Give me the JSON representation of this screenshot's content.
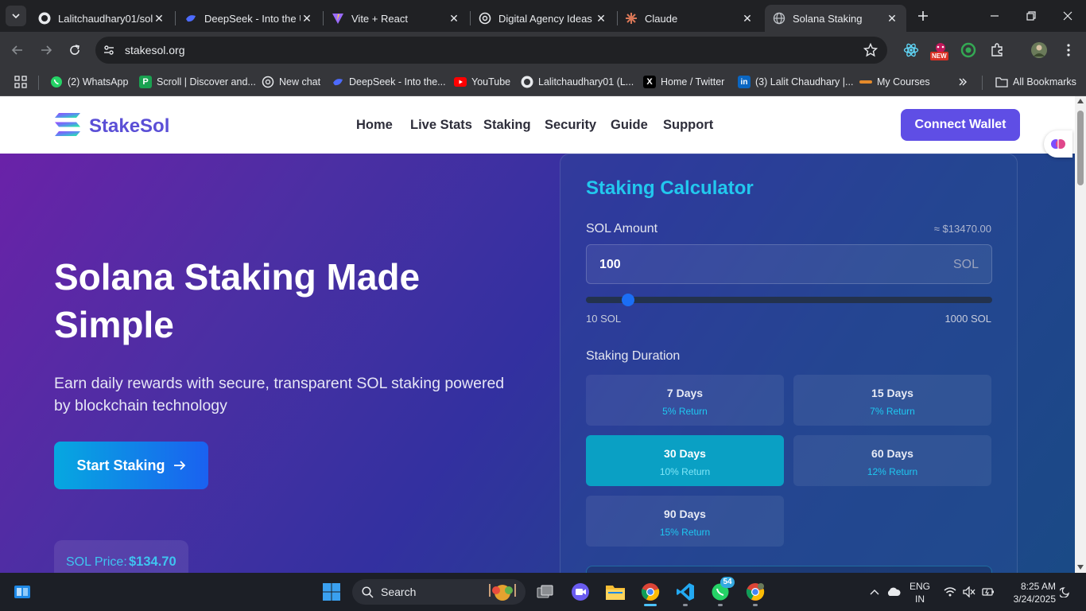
{
  "browser": {
    "tabs": [
      {
        "title": "Lalitchaudhary01/sol",
        "icon": "github-icon"
      },
      {
        "title": "DeepSeek - Into the U",
        "icon": "deepseek-icon"
      },
      {
        "title": "Vite + React",
        "icon": "vite-icon"
      },
      {
        "title": "Digital Agency Ideas",
        "icon": "openai-icon"
      },
      {
        "title": "Claude",
        "icon": "claude-icon"
      },
      {
        "title": "Solana Staking",
        "icon": "globe-icon",
        "active": true
      }
    ],
    "url": "stakesol.org",
    "new_badge": "NEW",
    "bookmarks": [
      {
        "label": "(2) WhatsApp",
        "icon": "whatsapp-icon"
      },
      {
        "label": "Scroll | Discover and...",
        "icon": "scroll-icon"
      },
      {
        "label": "New chat",
        "icon": "openai-icon"
      },
      {
        "label": "DeepSeek - Into the...",
        "icon": "deepseek-icon"
      },
      {
        "label": "YouTube",
        "icon": "youtube-icon"
      },
      {
        "label": "Lalitchaudhary01 (L...",
        "icon": "github-icon"
      },
      {
        "label": "Home / Twitter",
        "icon": "x-icon"
      },
      {
        "label": "(3) Lalit Chaudhary |...",
        "icon": "linkedin-icon"
      },
      {
        "label": "My Courses",
        "icon": "courses-icon"
      }
    ],
    "all_bookmarks": "All Bookmarks"
  },
  "site": {
    "brand": "StakeSol",
    "nav": [
      "Home",
      "Live Stats",
      "Staking",
      "Security",
      "Guide",
      "Support"
    ],
    "connect_wallet": "Connect Wallet",
    "hero": {
      "title": "Solana Staking Made Simple",
      "subtitle": "Earn daily rewards with secure, transparent SOL staking powered by blockchain technology",
      "cta": "Start Staking",
      "price_label": "SOL Price:",
      "price_value": "$134.70"
    },
    "calculator": {
      "title": "Staking Calculator",
      "amount_label": "SOL Amount",
      "usd_estimate": "≈ $13470.00",
      "amount_value": "100",
      "unit": "SOL",
      "slider_min_label": "10 SOL",
      "slider_max_label": "1000 SOL",
      "slider_value_fraction": 0.0909,
      "duration_label": "Staking Duration",
      "durations": [
        {
          "days": "7 Days",
          "ret": "5% Return"
        },
        {
          "days": "15 Days",
          "ret": "7% Return"
        },
        {
          "days": "30 Days",
          "ret": "10% Return",
          "selected": true
        },
        {
          "days": "60 Days",
          "ret": "12% Return"
        },
        {
          "days": "90 Days",
          "ret": "15% Return"
        }
      ]
    }
  },
  "taskbar": {
    "search": "Search",
    "whatsapp_badge": "54",
    "lang": "ENG",
    "region": "IN",
    "time": "8:25 AM",
    "date": "3/24/2025"
  },
  "colors": {
    "brand": "#5f4ee5",
    "accent_cyan": "#22c8ee",
    "hero_start": "#6a22a8",
    "hero_end": "#1a4a86"
  }
}
